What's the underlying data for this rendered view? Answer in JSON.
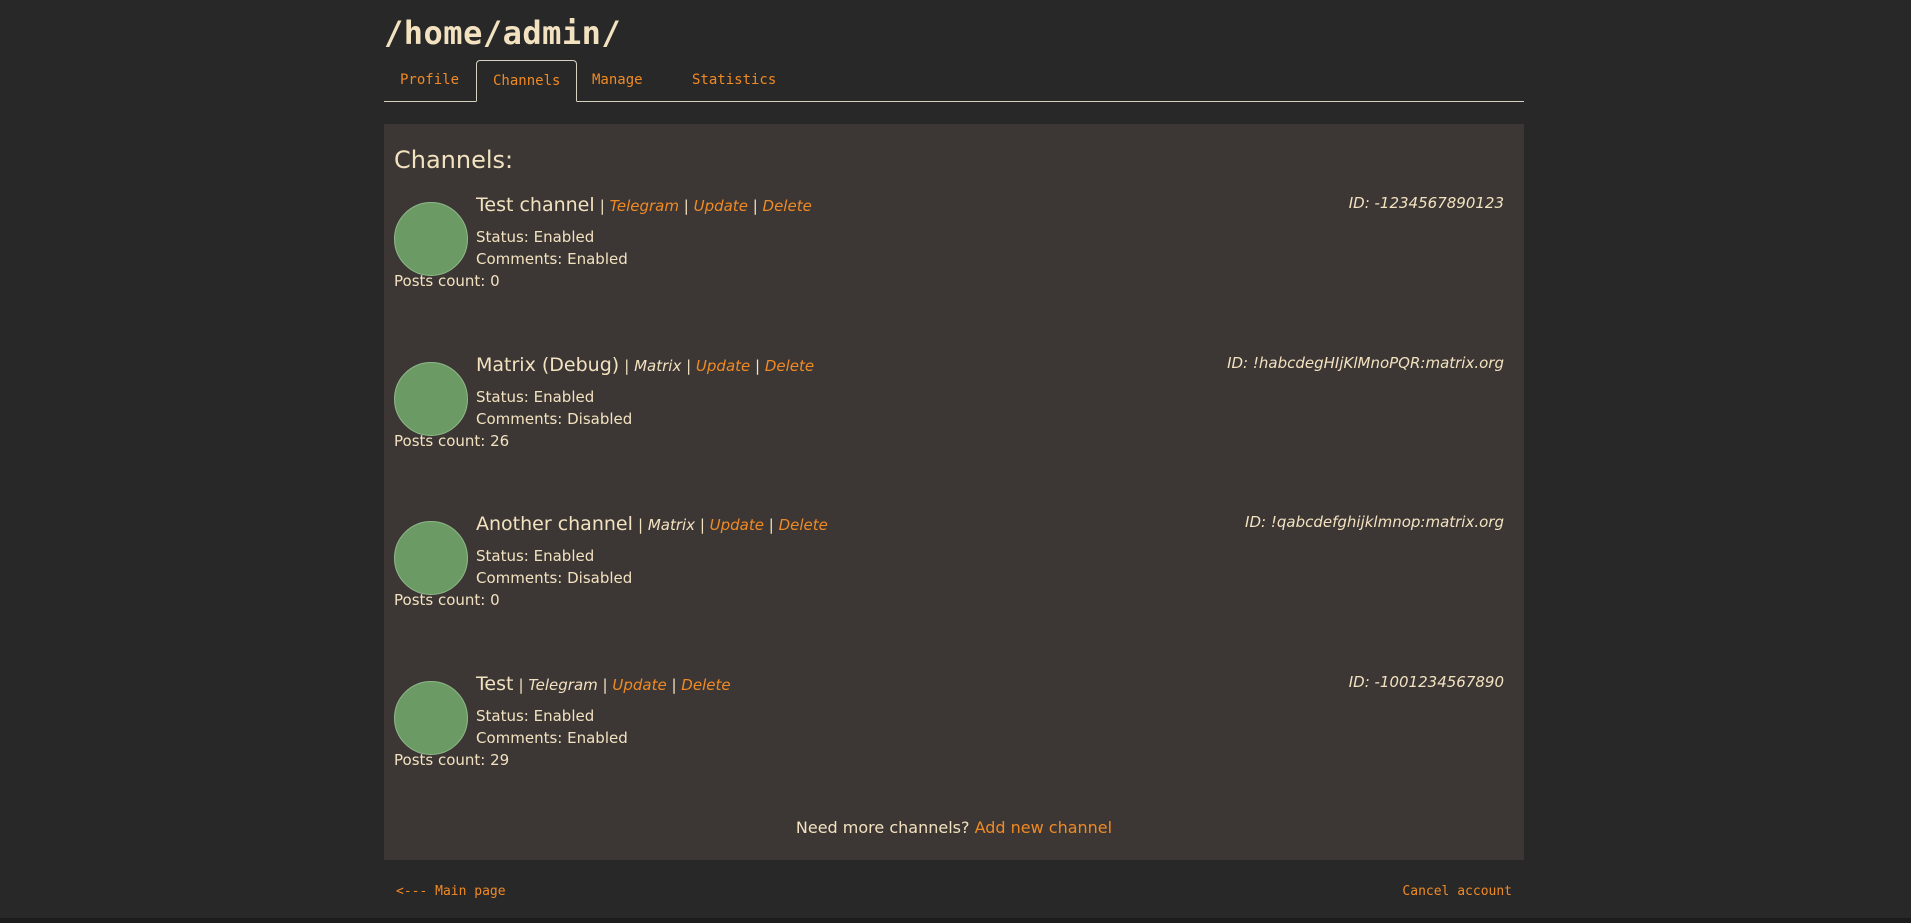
{
  "header": {
    "path": "/home/admin/"
  },
  "tabs": [
    {
      "label": "Profile"
    },
    {
      "label": "Channels"
    },
    {
      "label": "Manage"
    },
    {
      "label": "Statistics"
    }
  ],
  "panel": {
    "title": "Channels:"
  },
  "channels": [
    {
      "name": "Test channel",
      "platform": "Telegram",
      "update": "Update",
      "delete": "Delete",
      "id": "ID: -1234567890123",
      "status": "Status: Enabled",
      "comments": "Comments: Enabled",
      "posts": "Posts count: 0"
    },
    {
      "name": "Matrix (Debug)",
      "platform": "Matrix",
      "update": "Update",
      "delete": "Delete",
      "id": "ID: !habcdegHIjKlMnoPQR:matrix.org",
      "status": "Status: Enabled",
      "comments": "Comments: Disabled",
      "posts": "Posts count: 26"
    },
    {
      "name": "Another channel",
      "platform": "Matrix",
      "update": "Update",
      "delete": "Delete",
      "id": "ID: !qabcdefghijklmnop:matrix.org",
      "status": "Status: Enabled",
      "comments": "Comments: Disabled",
      "posts": "Posts count: 0"
    },
    {
      "name": "Test",
      "platform": "Telegram",
      "update": "Update",
      "delete": "Delete",
      "id": "ID: -1001234567890",
      "status": "Status: Enabled",
      "comments": "Comments: Enabled",
      "posts": "Posts count: 29"
    }
  ],
  "footer": {
    "more_text": "Need more channels?",
    "add_link": "Add new channel",
    "main_page": "<--- Main page",
    "cancel": "Cancel account"
  },
  "colors": {
    "background": "#282828",
    "panel": "#3c3734",
    "accent": "#f08a24",
    "text": "#f3e2c0",
    "avatar": "#6c9a64"
  }
}
